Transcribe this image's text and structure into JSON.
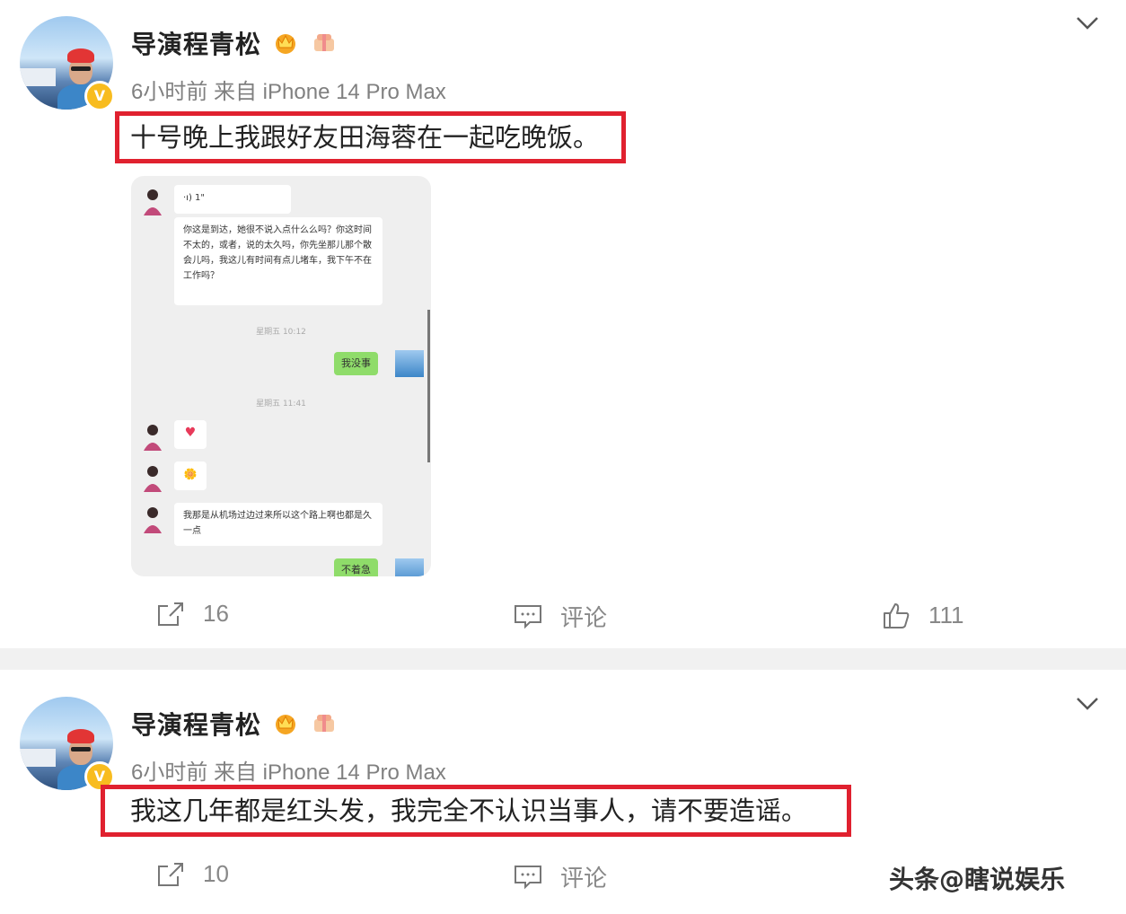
{
  "posts": [
    {
      "username": "导演程青松",
      "meta": "6小时前  来自 iPhone 14 Pro Max",
      "verified_mark": "V",
      "text": "十号晚上我跟好友田海蓉在一起吃晚饭。",
      "chat": {
        "voice_label": "·ı) 1\"",
        "message1": "你这是到达，她很不说入点什么么吗？你这时间不太的，或者，说的太久吗，你先坐那儿那个散会儿吗，我这儿有时间有点儿堵车，我下午不在工作吗？",
        "time1": "星期五 10:12",
        "reply1": "我没事",
        "time2": "星期五 11:41",
        "heart": "♥",
        "flower": "🌼",
        "message2": "我那是从机场过边过来所以这个路上啊也都是久一点",
        "reply2": "不着急"
      },
      "reposts": "16",
      "comments_label": "评论",
      "likes": "111"
    },
    {
      "username": "导演程青松",
      "meta": "6小时前  来自 iPhone 14 Pro Max",
      "verified_mark": "V",
      "text": "我这几年都是红头发，我完全不认识当事人，请不要造谣。",
      "reposts": "10",
      "comments_label": "评论"
    }
  ],
  "watermark": "头条@瞎说娱乐",
  "colors": {
    "highlight_border": "#e0212f",
    "verified_badge": "#f8bc1f",
    "chat_sent_bubble": "#8fdc6a"
  },
  "icons": [
    "chevron-down-icon",
    "crown-badge-icon",
    "gift-badge-icon",
    "repost-icon",
    "comment-icon",
    "like-icon"
  ]
}
